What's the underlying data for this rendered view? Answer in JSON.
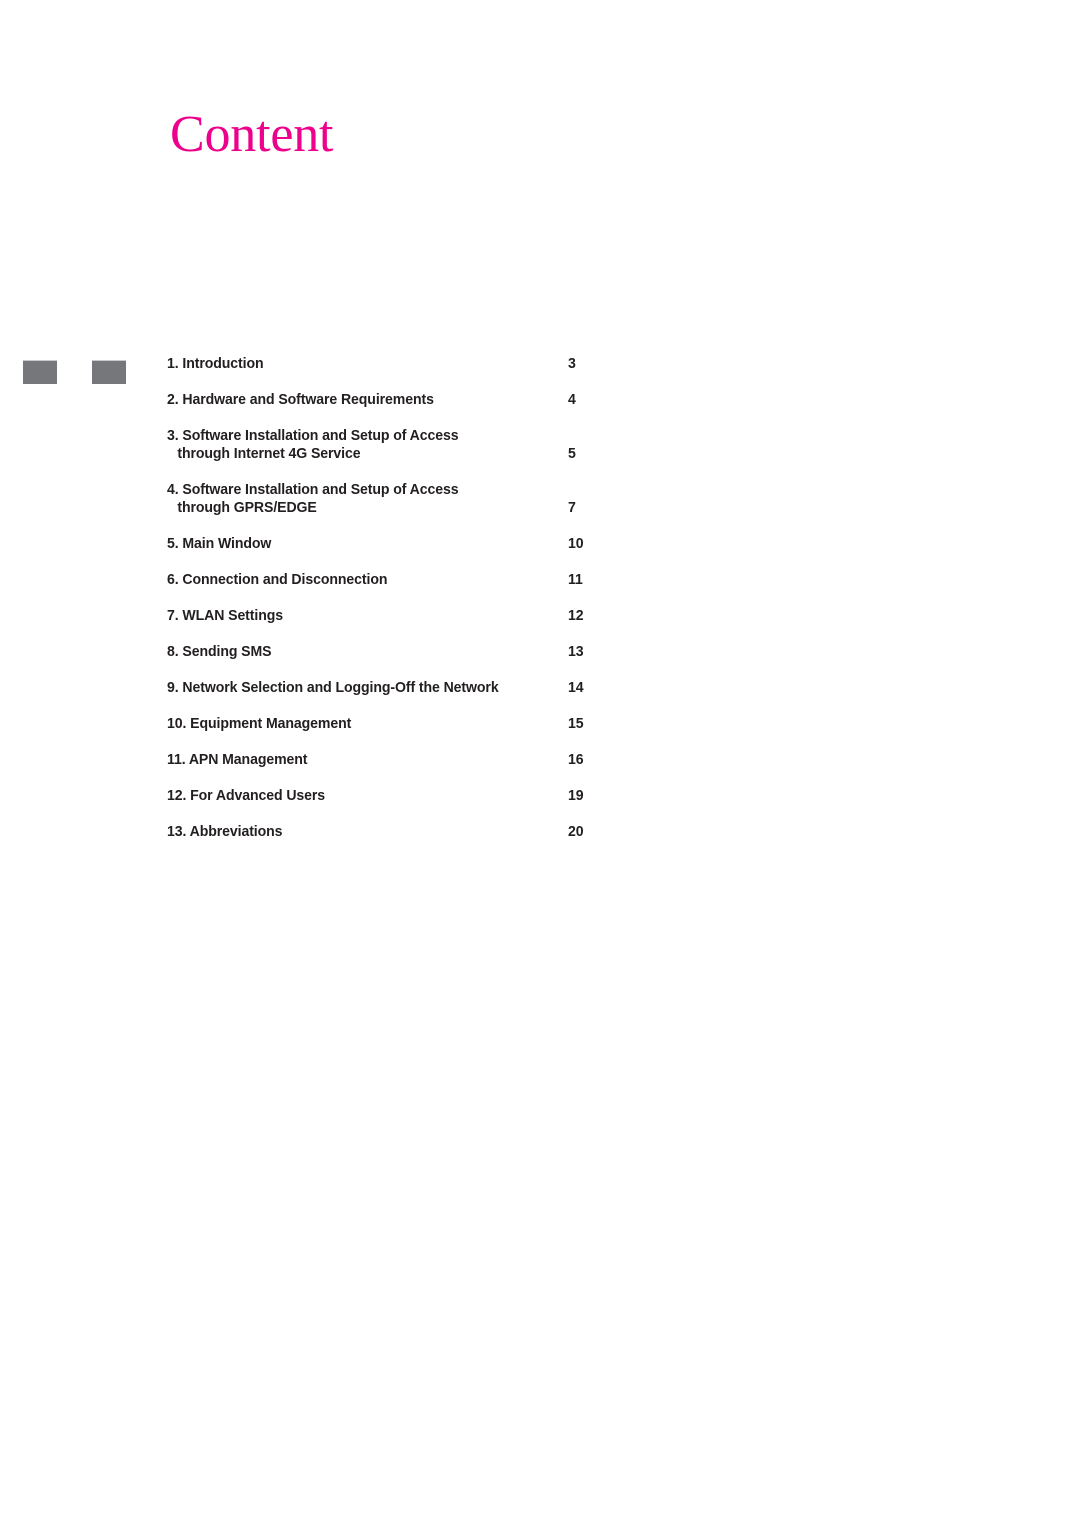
{
  "document": {
    "title": "Content",
    "title_color": "#EC008C",
    "text_color": "#231F20",
    "background_color": "#FFFFFF",
    "marker_color": "#76777B"
  },
  "margin_marks": [
    {
      "name": "square-1"
    },
    {
      "name": "square-2"
    }
  ],
  "toc": {
    "entries": [
      {
        "label": "1. Introduction",
        "label_line2": "",
        "page": "3"
      },
      {
        "label": "2. Hardware and Software Requirements",
        "label_line2": "",
        "page": "4"
      },
      {
        "label": "3. Software Installation and Setup of Access",
        "label_line2": "through Internet 4G Service",
        "page": "5"
      },
      {
        "label": "4. Software Installation and Setup of Access",
        "label_line2": "through GPRS/EDGE",
        "page": "7"
      },
      {
        "label": "5. Main Window",
        "label_line2": "",
        "page": "10"
      },
      {
        "label": "6. Connection and Disconnection",
        "label_line2": "",
        "page": "11"
      },
      {
        "label": "7. WLAN Settings",
        "label_line2": "",
        "page": "12"
      },
      {
        "label": "8. Sending SMS",
        "label_line2": "",
        "page": "13"
      },
      {
        "label": "9. Network Selection and Logging-Off the Network",
        "label_line2": "",
        "page": "14"
      },
      {
        "label": "10. Equipment Management",
        "label_line2": "",
        "page": "15"
      },
      {
        "label": "11. APN Management",
        "label_line2": "",
        "page": "16"
      },
      {
        "label": "12. For Advanced Users",
        "label_line2": "",
        "page": "19"
      },
      {
        "label": "13. Abbreviations",
        "label_line2": "",
        "page": "20"
      }
    ]
  }
}
